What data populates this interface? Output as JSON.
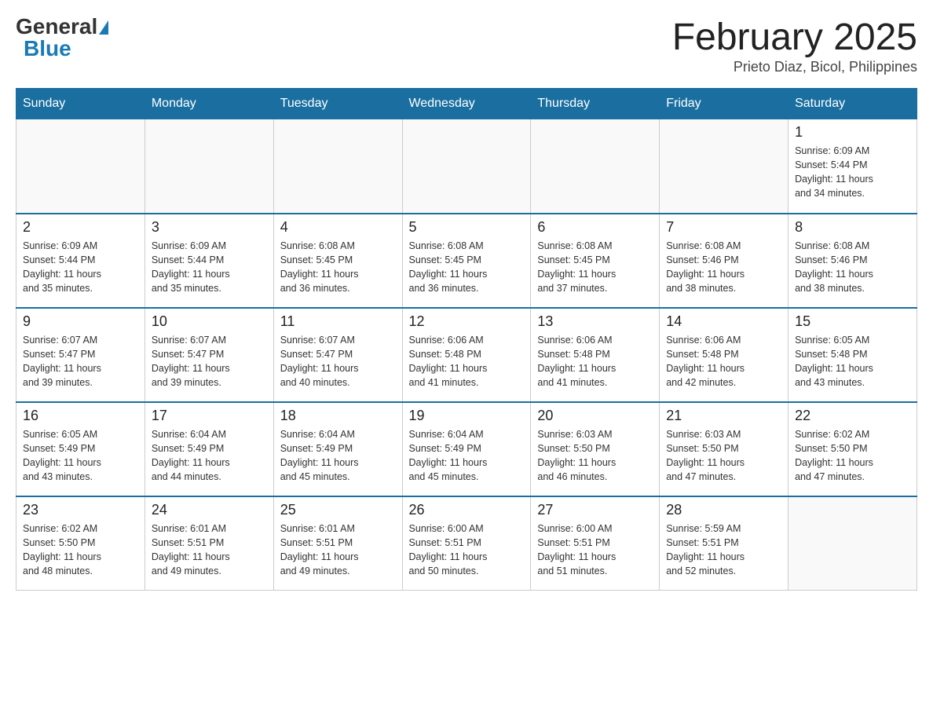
{
  "header": {
    "logo_general": "General",
    "logo_blue": "Blue",
    "month_title": "February 2025",
    "location": "Prieto Diaz, Bicol, Philippines"
  },
  "days_of_week": [
    "Sunday",
    "Monday",
    "Tuesday",
    "Wednesday",
    "Thursday",
    "Friday",
    "Saturday"
  ],
  "weeks": [
    {
      "days": [
        {
          "number": "",
          "info": ""
        },
        {
          "number": "",
          "info": ""
        },
        {
          "number": "",
          "info": ""
        },
        {
          "number": "",
          "info": ""
        },
        {
          "number": "",
          "info": ""
        },
        {
          "number": "",
          "info": ""
        },
        {
          "number": "1",
          "info": "Sunrise: 6:09 AM\nSunset: 5:44 PM\nDaylight: 11 hours\nand 34 minutes."
        }
      ]
    },
    {
      "days": [
        {
          "number": "2",
          "info": "Sunrise: 6:09 AM\nSunset: 5:44 PM\nDaylight: 11 hours\nand 35 minutes."
        },
        {
          "number": "3",
          "info": "Sunrise: 6:09 AM\nSunset: 5:44 PM\nDaylight: 11 hours\nand 35 minutes."
        },
        {
          "number": "4",
          "info": "Sunrise: 6:08 AM\nSunset: 5:45 PM\nDaylight: 11 hours\nand 36 minutes."
        },
        {
          "number": "5",
          "info": "Sunrise: 6:08 AM\nSunset: 5:45 PM\nDaylight: 11 hours\nand 36 minutes."
        },
        {
          "number": "6",
          "info": "Sunrise: 6:08 AM\nSunset: 5:45 PM\nDaylight: 11 hours\nand 37 minutes."
        },
        {
          "number": "7",
          "info": "Sunrise: 6:08 AM\nSunset: 5:46 PM\nDaylight: 11 hours\nand 38 minutes."
        },
        {
          "number": "8",
          "info": "Sunrise: 6:08 AM\nSunset: 5:46 PM\nDaylight: 11 hours\nand 38 minutes."
        }
      ]
    },
    {
      "days": [
        {
          "number": "9",
          "info": "Sunrise: 6:07 AM\nSunset: 5:47 PM\nDaylight: 11 hours\nand 39 minutes."
        },
        {
          "number": "10",
          "info": "Sunrise: 6:07 AM\nSunset: 5:47 PM\nDaylight: 11 hours\nand 39 minutes."
        },
        {
          "number": "11",
          "info": "Sunrise: 6:07 AM\nSunset: 5:47 PM\nDaylight: 11 hours\nand 40 minutes."
        },
        {
          "number": "12",
          "info": "Sunrise: 6:06 AM\nSunset: 5:48 PM\nDaylight: 11 hours\nand 41 minutes."
        },
        {
          "number": "13",
          "info": "Sunrise: 6:06 AM\nSunset: 5:48 PM\nDaylight: 11 hours\nand 41 minutes."
        },
        {
          "number": "14",
          "info": "Sunrise: 6:06 AM\nSunset: 5:48 PM\nDaylight: 11 hours\nand 42 minutes."
        },
        {
          "number": "15",
          "info": "Sunrise: 6:05 AM\nSunset: 5:48 PM\nDaylight: 11 hours\nand 43 minutes."
        }
      ]
    },
    {
      "days": [
        {
          "number": "16",
          "info": "Sunrise: 6:05 AM\nSunset: 5:49 PM\nDaylight: 11 hours\nand 43 minutes."
        },
        {
          "number": "17",
          "info": "Sunrise: 6:04 AM\nSunset: 5:49 PM\nDaylight: 11 hours\nand 44 minutes."
        },
        {
          "number": "18",
          "info": "Sunrise: 6:04 AM\nSunset: 5:49 PM\nDaylight: 11 hours\nand 45 minutes."
        },
        {
          "number": "19",
          "info": "Sunrise: 6:04 AM\nSunset: 5:49 PM\nDaylight: 11 hours\nand 45 minutes."
        },
        {
          "number": "20",
          "info": "Sunrise: 6:03 AM\nSunset: 5:50 PM\nDaylight: 11 hours\nand 46 minutes."
        },
        {
          "number": "21",
          "info": "Sunrise: 6:03 AM\nSunset: 5:50 PM\nDaylight: 11 hours\nand 47 minutes."
        },
        {
          "number": "22",
          "info": "Sunrise: 6:02 AM\nSunset: 5:50 PM\nDaylight: 11 hours\nand 47 minutes."
        }
      ]
    },
    {
      "days": [
        {
          "number": "23",
          "info": "Sunrise: 6:02 AM\nSunset: 5:50 PM\nDaylight: 11 hours\nand 48 minutes."
        },
        {
          "number": "24",
          "info": "Sunrise: 6:01 AM\nSunset: 5:51 PM\nDaylight: 11 hours\nand 49 minutes."
        },
        {
          "number": "25",
          "info": "Sunrise: 6:01 AM\nSunset: 5:51 PM\nDaylight: 11 hours\nand 49 minutes."
        },
        {
          "number": "26",
          "info": "Sunrise: 6:00 AM\nSunset: 5:51 PM\nDaylight: 11 hours\nand 50 minutes."
        },
        {
          "number": "27",
          "info": "Sunrise: 6:00 AM\nSunset: 5:51 PM\nDaylight: 11 hours\nand 51 minutes."
        },
        {
          "number": "28",
          "info": "Sunrise: 5:59 AM\nSunset: 5:51 PM\nDaylight: 11 hours\nand 52 minutes."
        },
        {
          "number": "",
          "info": ""
        }
      ]
    }
  ]
}
